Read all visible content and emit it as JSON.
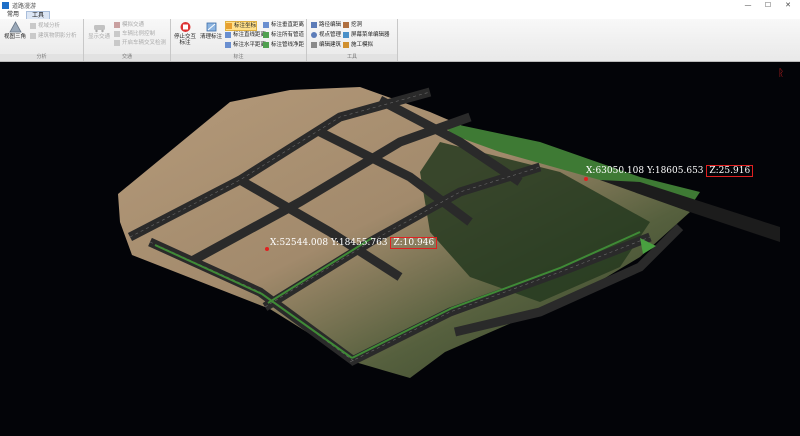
{
  "window": {
    "title": "道路漫游",
    "minimize": "—",
    "maximize": "☐",
    "close": "✕"
  },
  "tabs": [
    {
      "label": "常用"
    },
    {
      "label": "工具"
    }
  ],
  "ribbon": {
    "groups": [
      {
        "label": "分析"
      },
      {
        "label": "交通"
      },
      {
        "label": "标注"
      },
      {
        "label": "工具"
      }
    ],
    "analysis": {
      "view_triangle": "视图三角",
      "viewshed": "视域分析",
      "building_shadow": "建筑物阴影分析"
    },
    "traffic": {
      "show_traffic": "显示交通",
      "simulate": "模拟交通",
      "vehicle_model": "车辆比例控制",
      "intersection_check": "开启车辆交叉检测"
    },
    "annotation": {
      "stop_annotation": "停止交互标注",
      "clear_annotation": "清理标注",
      "coord": "标注坐标",
      "straight_dist": "标注直线距离",
      "horizontal_dist": "标注水平距离",
      "vertical_dist": "标注垂直距离",
      "all_pipes": "标注所有管道",
      "pipe_net": "标注管线净距"
    },
    "tools": {
      "path_edit": "路径编辑",
      "viewpoint_mgmt": "视点管理",
      "building_edit": "编辑建筑",
      "excavate": "挖洞",
      "screen_editor": "屏幕菜单编辑器",
      "construction_sim": "施工模拟"
    }
  },
  "labels": [
    {
      "x": "X:63050.108",
      "y": "Y:18605.653",
      "z": "Z:25.916"
    },
    {
      "x": "X:52544.008",
      "y": "Y:18455.763",
      "z": "Z:10.946"
    }
  ],
  "colors": {
    "ribbon_bg": "#efefef",
    "viewport_bg": "#030408",
    "marker": "#e02020"
  }
}
